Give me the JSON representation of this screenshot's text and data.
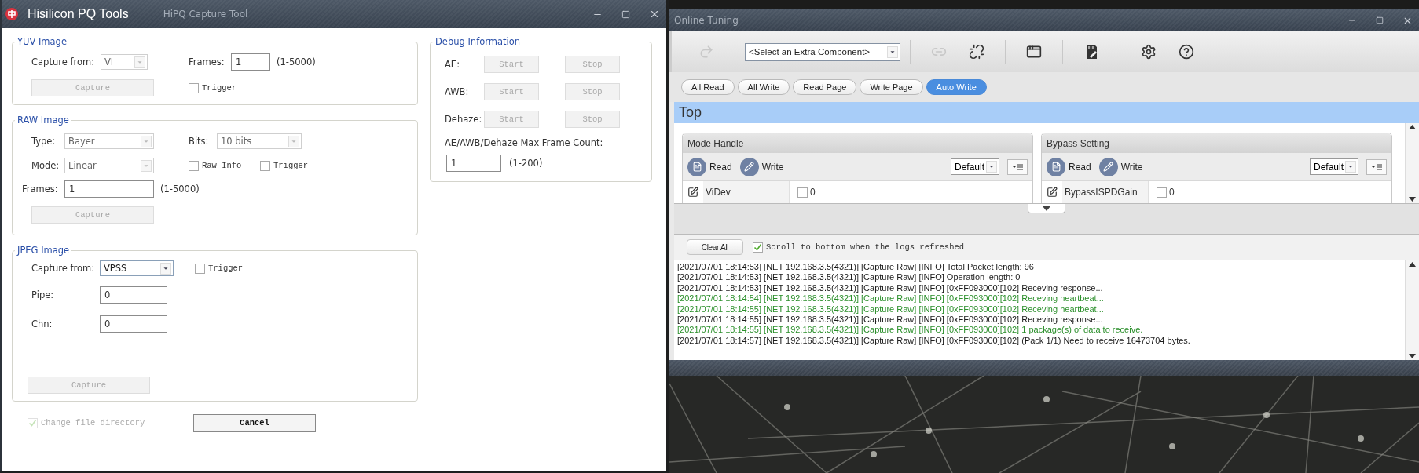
{
  "capture_window": {
    "title": "Hisilicon PQ Tools",
    "subtitle": "HiPQ Capture Tool",
    "yuv_image": {
      "title": "YUV Image",
      "capture_from_label": "Capture from:",
      "capture_from": {
        "value": "VI",
        "disabled": true
      },
      "frames_label": "Frames:",
      "frames_value": "1",
      "frames_range": "(1-5000)",
      "capture_button": {
        "label": "Capture",
        "disabled": true
      },
      "trigger": {
        "label": "Trigger",
        "checked": false
      }
    },
    "raw_image": {
      "title": "RAW Image",
      "type_label": "Type:",
      "type": {
        "value": "Bayer",
        "disabled": true
      },
      "bits_label": "Bits:",
      "bits": {
        "value": "10 bits",
        "disabled": true
      },
      "mode_label": "Mode:",
      "mode": {
        "value": "Linear",
        "disabled": true
      },
      "raw_info": {
        "label": "Raw Info",
        "checked": false
      },
      "trigger": {
        "label": "Trigger",
        "checked": false
      },
      "frames_label": "Frames:",
      "frames_value": "1",
      "frames_range": "(1-5000)",
      "capture_button": {
        "label": "Capture",
        "disabled": true
      }
    },
    "jpeg_image": {
      "title": "JPEG Image",
      "capture_from_label": "Capture from:",
      "capture_from": {
        "value": "VPSS",
        "disabled": false
      },
      "trigger": {
        "label": "Trigger",
        "checked": false
      },
      "pipe_label": "Pipe:",
      "pipe_value": "0",
      "chn_label": "Chn:",
      "chn_value": "0",
      "capture_button": {
        "label": "Capture",
        "disabled": true
      }
    },
    "debug_information": {
      "title": "Debug Information",
      "rows": [
        {
          "label": "AE:",
          "start": {
            "label": "Start",
            "disabled": true
          },
          "stop": {
            "label": "Stop",
            "disabled": true
          }
        },
        {
          "label": "AWB:",
          "start": {
            "label": "Start",
            "disabled": true
          },
          "stop": {
            "label": "Stop",
            "disabled": true
          }
        },
        {
          "label": "Dehaze:",
          "start": {
            "label": "Start",
            "disabled": true
          },
          "stop": {
            "label": "Stop",
            "disabled": true
          }
        }
      ],
      "max_frame_label": "AE/AWB/Dehaze Max Frame Count:",
      "max_frame_value": "1",
      "max_frame_range": "(1-200)"
    },
    "change_file_directory": {
      "label": "Change file directory",
      "checked": true,
      "disabled": true
    },
    "cancel_button": "Cancel"
  },
  "tuning_window": {
    "title": "Online Tuning",
    "toolbar": {
      "tools": [
        {
          "kind": "redo",
          "disabled": true
        },
        {
          "kind": "component_select",
          "value": "<Select an Extra Component>"
        },
        {
          "kind": "link",
          "disabled": true
        },
        {
          "kind": "unlink",
          "disabled": false
        },
        {
          "kind": "window",
          "disabled": false
        },
        {
          "kind": "card",
          "disabled": false
        },
        {
          "kind": "settings",
          "disabled": false
        },
        {
          "kind": "help",
          "disabled": false
        }
      ]
    },
    "actions": [
      {
        "label": "All Read",
        "selected": false
      },
      {
        "label": "All Write",
        "selected": false
      },
      {
        "label": "Read Page",
        "selected": false
      },
      {
        "label": "Write Page",
        "selected": false
      },
      {
        "label": "Auto Write",
        "selected": true
      }
    ],
    "section_title": "Top",
    "panels": [
      {
        "title": "Mode Handle",
        "read": "Read",
        "write": "Write",
        "preset": "Default",
        "rows": [
          {
            "name": "ViDev",
            "checked": false,
            "value": "0"
          }
        ]
      },
      {
        "title": "Bypass Setting",
        "read": "Read",
        "write": "Write",
        "preset": "Default",
        "rows": [
          {
            "name": "BypassISPDGain",
            "checked": false,
            "value": "0"
          }
        ]
      }
    ],
    "clear_all": "Clear All",
    "scroll_to_bottom": {
      "label": "Scroll to bottom when the logs refreshed",
      "checked": true
    },
    "log": [
      {
        "kind": "normal",
        "text": "[2021/07/01 18:14:53] [NET 192.168.3.5(4321)] [Capture Raw] [INFO] Total Packet length: 96"
      },
      {
        "kind": "normal",
        "text": "[2021/07/01 18:14:53] [NET 192.168.3.5(4321)] [Capture Raw] [INFO] Operation length: 0"
      },
      {
        "kind": "normal",
        "text": "[2021/07/01 18:14:53] [NET 192.168.3.5(4321)] [Capture Raw] [INFO] [0xFF093000][102] Receving response..."
      },
      {
        "kind": "success",
        "text": "[2021/07/01 18:14:54] [NET 192.168.3.5(4321)] [Capture Raw] [INFO] [0xFF093000][102] Receving heartbeat..."
      },
      {
        "kind": "success",
        "text": "[2021/07/01 18:14:55] [NET 192.168.3.5(4321)] [Capture Raw] [INFO] [0xFF093000][102] Receving heartbeat..."
      },
      {
        "kind": "normal",
        "text": "[2021/07/01 18:14:55] [NET 192.168.3.5(4321)] [Capture Raw] [INFO] [0xFF093000][102] Receving response..."
      },
      {
        "kind": "success",
        "text": "[2021/07/01 18:14:55] [NET 192.168.3.5(4321)] [Capture Raw] [INFO] [0xFF093000][102] 1 package(s) of data to receive."
      },
      {
        "kind": "normal",
        "text": "[2021/07/01 18:14:57] [NET 192.168.3.5(4321)] [Capture Raw] [INFO] [0xFF093000][102] (Pack 1/1) Need to receive 16473704 bytes."
      }
    ]
  }
}
